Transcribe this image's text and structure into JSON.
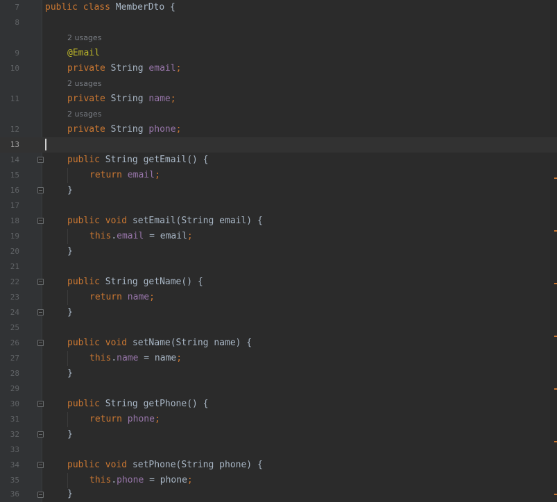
{
  "editor": {
    "lines": {
      "7": {
        "num": "7",
        "t": [
          "public",
          "class",
          "MemberDto {"
        ]
      },
      "8": {
        "num": "8"
      },
      "9": {
        "num": "9",
        "hint": "2 usages",
        "t": [
          "@Email"
        ]
      },
      "10": {
        "num": "10",
        "t": [
          "private",
          "String",
          "email",
          ";"
        ]
      },
      "11": {
        "num": "11",
        "hint": "2 usages",
        "t": [
          "private",
          "String",
          "name",
          ";"
        ]
      },
      "12": {
        "num": "12",
        "hint": "2 usages",
        "t": [
          "private",
          "String",
          "phone",
          ";"
        ]
      },
      "13": {
        "num": "13"
      },
      "14": {
        "num": "14",
        "t": [
          "public",
          "String getEmail() {"
        ]
      },
      "15": {
        "num": "15",
        "t": [
          "return",
          "email",
          ";"
        ]
      },
      "16": {
        "num": "16",
        "t": [
          "}"
        ]
      },
      "17": {
        "num": "17"
      },
      "18": {
        "num": "18",
        "t": [
          "public",
          "void",
          "setEmail(String email) {"
        ]
      },
      "19": {
        "num": "19",
        "t": [
          "this",
          ".",
          "email",
          " = email",
          ";"
        ]
      },
      "20": {
        "num": "20",
        "t": [
          "}"
        ]
      },
      "21": {
        "num": "21"
      },
      "22": {
        "num": "22",
        "t": [
          "public",
          "String getName() {"
        ]
      },
      "23": {
        "num": "23",
        "t": [
          "return",
          "name",
          ";"
        ]
      },
      "24": {
        "num": "24",
        "t": [
          "}"
        ]
      },
      "25": {
        "num": "25"
      },
      "26": {
        "num": "26",
        "t": [
          "public",
          "void",
          "setName(String name) {"
        ]
      },
      "27": {
        "num": "27",
        "t": [
          "this",
          ".",
          "name",
          " = name",
          ";"
        ]
      },
      "28": {
        "num": "28",
        "t": [
          "}"
        ]
      },
      "29": {
        "num": "29"
      },
      "30": {
        "num": "30",
        "t": [
          "public",
          "String getPhone() {"
        ]
      },
      "31": {
        "num": "31",
        "t": [
          "return",
          "phone",
          ";"
        ]
      },
      "32": {
        "num": "32",
        "t": [
          "}"
        ]
      },
      "33": {
        "num": "33"
      },
      "34": {
        "num": "34",
        "t": [
          "public",
          "void",
          "setPhone(String phone) {"
        ]
      },
      "35": {
        "num": "35",
        "t": [
          "this",
          ".",
          "phone",
          " = phone",
          ";"
        ]
      },
      "36": {
        "num": "36",
        "t": [
          "}"
        ]
      }
    },
    "current_line": "13"
  },
  "theme": {
    "background": "#2b2b2b",
    "keyword": "#cc7832",
    "field": "#9876aa",
    "annotation": "#bbb529",
    "text": "#a9b7c6",
    "line_number": "#606366"
  }
}
